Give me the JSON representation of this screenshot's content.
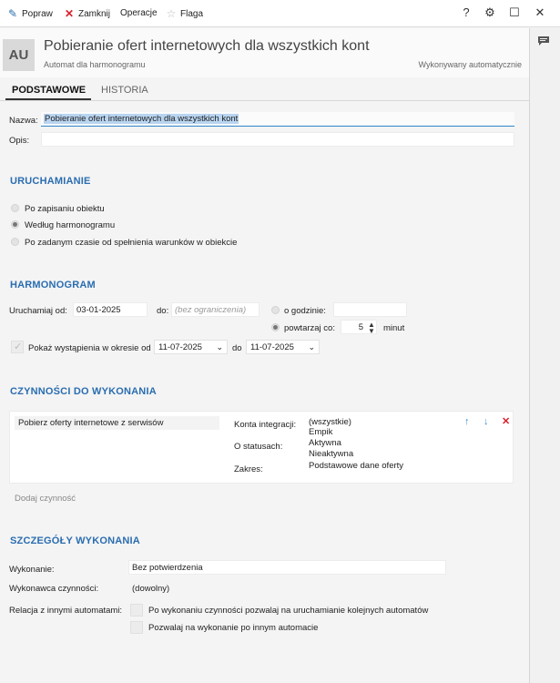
{
  "toolbar": {
    "popraw": "Popraw",
    "zamknij": "Zamknij",
    "operacje": "Operacje",
    "flaga": "Flaga",
    "help": "?",
    "gear": "⚙",
    "maximize": "☐",
    "close": "✕"
  },
  "header": {
    "avatar": "AU",
    "title": "Pobieranie ofert internetowych dla wszystkich kont",
    "subtitle": "Automat dla harmonogramu",
    "status": "Wykonywany automatycznie"
  },
  "tabs": {
    "basic": "PODSTAWOWE",
    "history": "HISTORIA"
  },
  "form": {
    "name_label": "Nazwa:",
    "name_value": "Pobieranie ofert internetowych dla wszystkich kont",
    "desc_label": "Opis:",
    "desc_value": ""
  },
  "run": {
    "section": "URUCHAMIANIE",
    "options": [
      "Po zapisaniu obiektu",
      "Według harmonogramu",
      "Po zadanym czasie od spełnienia warunków w obiekcie"
    ],
    "selected_index": 1
  },
  "schedule": {
    "section": "HARMONOGRAM",
    "start_label": "Uruchamiaj od:",
    "start_value": "03-01-2025",
    "to_label": "do:",
    "to_placeholder": "(bez ograniczenia)",
    "at_hour_label": "o godzinie:",
    "repeat_label": "powtarzaj co:",
    "repeat_value": "5",
    "repeat_unit": "minut",
    "show_label": "Pokaż wystąpienia w okresie od",
    "show_from": "11-07-2025",
    "show_to_label": "do",
    "show_to": "11-07-2025"
  },
  "actions": {
    "section": "CZYNNOŚCI DO WYKONANIA",
    "item_name": "Pobierz oferty internetowe z serwisów",
    "accounts_label": "Konta integracji:",
    "accounts_values": [
      "(wszystkie)",
      "Empik"
    ],
    "statuses_label": "O statusach:",
    "statuses_values": [
      "Aktywna",
      "Nieaktywna"
    ],
    "scope_label": "Zakres:",
    "scope_value": "Podstawowe dane oferty",
    "add_action": "Dodaj czynność"
  },
  "details": {
    "section": "SZCZEGÓŁY WYKONANIA",
    "execution_label": "Wykonanie:",
    "execution_value": "Bez potwierdzenia",
    "performer_label": "Wykonawca czynności:",
    "performer_value": "(dowolny)",
    "relation_label": "Relacja z innymi automatami:",
    "relation_opt1": "Po wykonaniu czynności pozwalaj na uruchamianie kolejnych automatów",
    "relation_opt2": "Pozwalaj na wykonanie po innym automacie"
  },
  "colors": {
    "section_blue": "#2a6db0",
    "toolbar_close_red": "#d9202b",
    "arrow_blue": "#3c8fd6"
  }
}
